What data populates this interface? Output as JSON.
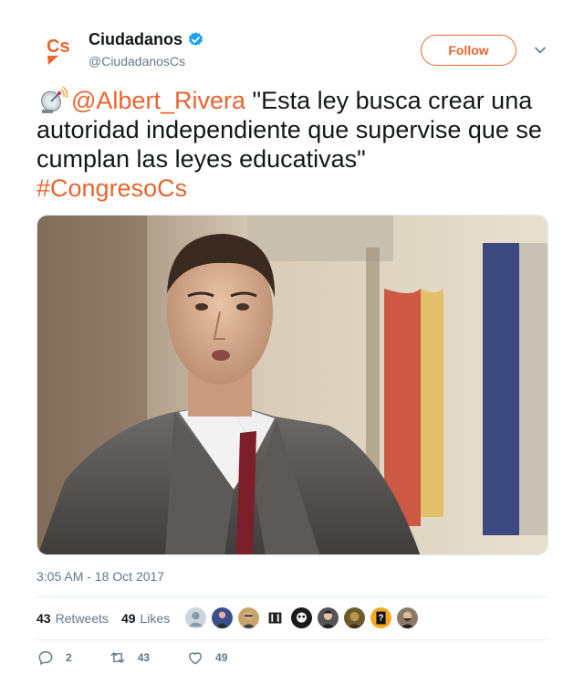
{
  "account": {
    "display_name": "Ciudadanos",
    "handle": "@CiudadanosCs",
    "logo_text": "Cs"
  },
  "follow_label": "Follow",
  "tweet": {
    "mention": "@Albert_Rivera",
    "quote": " \"Esta ley busca crear una autoridad independiente que supervise que se cumplan las leyes educativas\"",
    "hashtag": "#CongresoCs"
  },
  "timestamp": "3:05 AM - 18 Oct 2017",
  "stats": {
    "retweets_count": "43",
    "retweets_label": "Retweets",
    "likes_count": "49",
    "likes_label": "Likes"
  },
  "actions": {
    "reply_count": "2",
    "retweet_count": "43",
    "like_count": "49"
  },
  "colors": {
    "brand": "#e9642f",
    "verified": "#1da1f2"
  },
  "icons": [
    "satellite-antenna-icon",
    "verified-badge-icon",
    "chevron-down-icon",
    "reply-icon",
    "retweet-icon",
    "like-icon"
  ]
}
